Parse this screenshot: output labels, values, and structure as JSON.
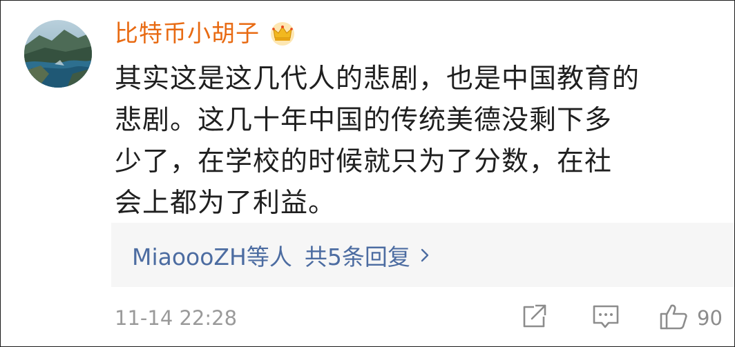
{
  "comment": {
    "username": "比特币小胡子",
    "badge_icon": "crown-icon",
    "text": "其实这是这几代人的悲剧，也是中国教育的\n悲剧。这几十年中国的传统美德没剩下多\n少了，在学校的时候就只为了分数，在社\n会上都为了利益。"
  },
  "replies": {
    "users": "MiaoooZH等人",
    "count_label": "共5条回复"
  },
  "footer": {
    "timestamp": "11-14 22:28",
    "like_count": "90",
    "share_icon": "share-icon",
    "comment_icon": "comment-icon",
    "like_icon": "thumbs-up-icon"
  },
  "colors": {
    "username": "#e86a12",
    "link": "#4c6ca1",
    "muted": "#9a9a9a",
    "reply_bg": "#f6f6f6"
  }
}
